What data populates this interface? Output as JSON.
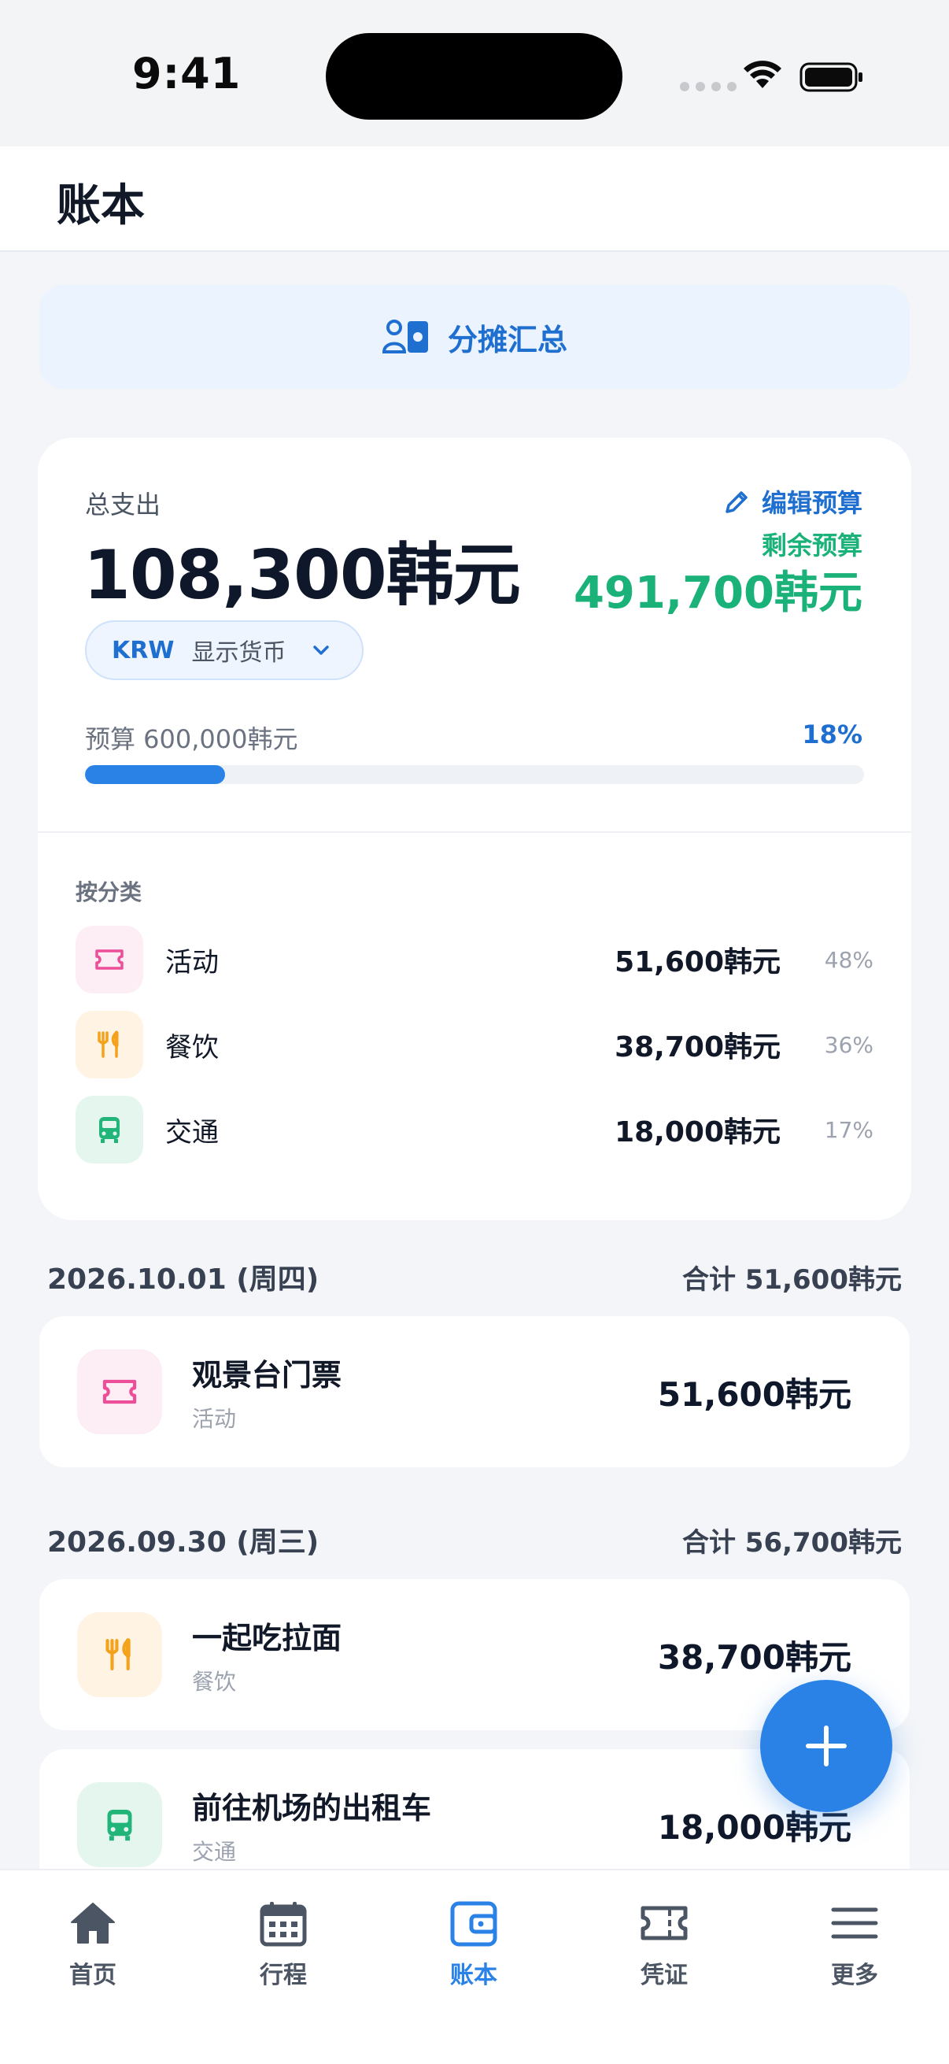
{
  "status_bar": {
    "time": "9:41"
  },
  "header": {
    "title": "账本"
  },
  "split_summary": {
    "label": "分摊汇总"
  },
  "summary": {
    "total_label": "总支出",
    "total_amount": "108,300韩元",
    "edit_budget_label": "编辑预算",
    "remaining_label": "剩余预算",
    "remaining_amount": "491,700韩元",
    "currency_code": "KRW",
    "currency_label": "显示货币",
    "budget_label": "预算 600,000韩元",
    "budget_percent": "18%",
    "budget_progress_fraction": 0.18,
    "category_heading": "按分类",
    "categories": [
      {
        "name": "活动",
        "amount": "51,600韩元",
        "percent": "48%",
        "icon": "ticket-icon"
      },
      {
        "name": "餐饮",
        "amount": "38,700韩元",
        "percent": "36%",
        "icon": "utensils-icon"
      },
      {
        "name": "交通",
        "amount": "18,000韩元",
        "percent": "17%",
        "icon": "bus-icon"
      }
    ]
  },
  "days": [
    {
      "date": "2026.10.01 (周四)",
      "total": "合计 51,600韩元",
      "items": [
        {
          "title": "观景台门票",
          "category": "活动",
          "amount": "51,600韩元",
          "icon": "ticket-icon"
        }
      ]
    },
    {
      "date": "2026.09.30 (周三)",
      "total": "合计 56,700韩元",
      "items": [
        {
          "title": "一起吃拉面",
          "category": "餐饮",
          "amount": "38,700韩元",
          "icon": "utensils-icon"
        },
        {
          "title": "前往机场的出租车",
          "category": "交通",
          "amount": "18,000韩元",
          "icon": "bus-icon"
        }
      ]
    }
  ],
  "tabs": [
    {
      "label": "首页",
      "icon": "home-icon"
    },
    {
      "label": "行程",
      "icon": "calendar-icon"
    },
    {
      "label": "账本",
      "icon": "wallet-icon",
      "active": true
    },
    {
      "label": "凭证",
      "icon": "ticket-icon"
    },
    {
      "label": "更多",
      "icon": "menu-icon"
    }
  ],
  "colors": {
    "accent": "#2b82e6",
    "green": "#1bb27a",
    "activity_pink": "#ec4f98",
    "dining_orange": "#f4a11c",
    "transport_green": "#21b57a"
  }
}
